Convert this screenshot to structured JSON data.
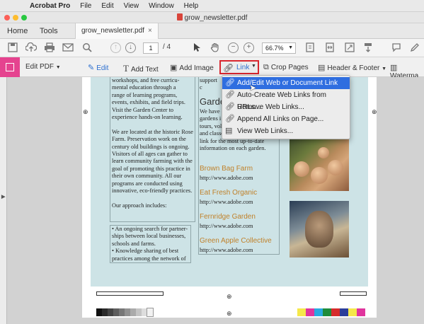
{
  "menubar": {
    "app_name": "Acrobat Pro",
    "items": [
      "File",
      "Edit",
      "View",
      "Window",
      "Help"
    ]
  },
  "window": {
    "title": "grow_newsletter.pdf"
  },
  "tabs": {
    "home": "Home",
    "tools": "Tools",
    "document": "grow_newsletter.pdf",
    "close_glyph": "×"
  },
  "toolbar": {
    "page_current": "1",
    "page_total": "/ 4",
    "zoom": "66.7%"
  },
  "edit_toolbar": {
    "title": "Edit PDF",
    "edit": "Edit",
    "add_text": "Add Text",
    "add_image": "Add Image",
    "link": "Link",
    "crop_pages": "Crop Pages",
    "header_footer": "Header & Footer",
    "watermark": "Waterma"
  },
  "link_menu": {
    "items": [
      {
        "label": "Add/Edit Web or Document Link",
        "icon": "link-icon",
        "selected": true
      },
      {
        "label": "Auto-Create Web Links from URLs...",
        "icon": "link-icon",
        "selected": false
      },
      {
        "label": "Remove Web Links...",
        "icon": "link-icon",
        "selected": false
      },
      {
        "label": "Append All Links on Page...",
        "icon": "link-icon",
        "selected": false
      },
      {
        "label": "View Web Links...",
        "icon": "document-icon",
        "selected": false
      }
    ]
  },
  "document": {
    "col1_text": "workshops, and free curricu-\nmental education through a\nrange of learning programs,\nevents, exhibits, and field trips.\nVisit the Garden Center to\nexperience hands-on learning.\n\nWe are located at the historic Rose\nFarm. Preservation work on the\ncentury old buildings is ongoing.\nVisitors of all ages can gather to\nlearn community farming with the\ngoal of promoting this practice in\ntheir own community. All our\nprograms are conducted using\ninnovative, eco-friendly practices.\n\nOur approach includes:",
    "col1b_text": "• An ongoing search for partner-\nships between local businesses,\nschools and farms.\n• Knowledge sharing of best\npractices among the network of",
    "col2_top": "support c",
    "col2_heading": "Garde",
    "col2_text": "We have c\ngardens i\ntours, vol\nand classe\nlink for the most up-to-date\ninformation on each garden.",
    "gardens": [
      {
        "name": "Brown Bag Farm",
        "url": "http://www.adobe.com"
      },
      {
        "name": "Eat Fresh Organic",
        "url": "http://www.adobe.com"
      },
      {
        "name": "Fernridge Garden",
        "url": "http://www.adobe.com"
      },
      {
        "name": "Green Apple Collective",
        "url": "http://www.adobe.com"
      }
    ],
    "registration_mark": "⊕",
    "brand_colors": {
      "accent_red": "#d9262e",
      "menu_highlight": "#2f6ee0",
      "edit_pink": "#e5438f",
      "subheading": "#c0812a",
      "page_tint": "#cde3e6"
    }
  }
}
